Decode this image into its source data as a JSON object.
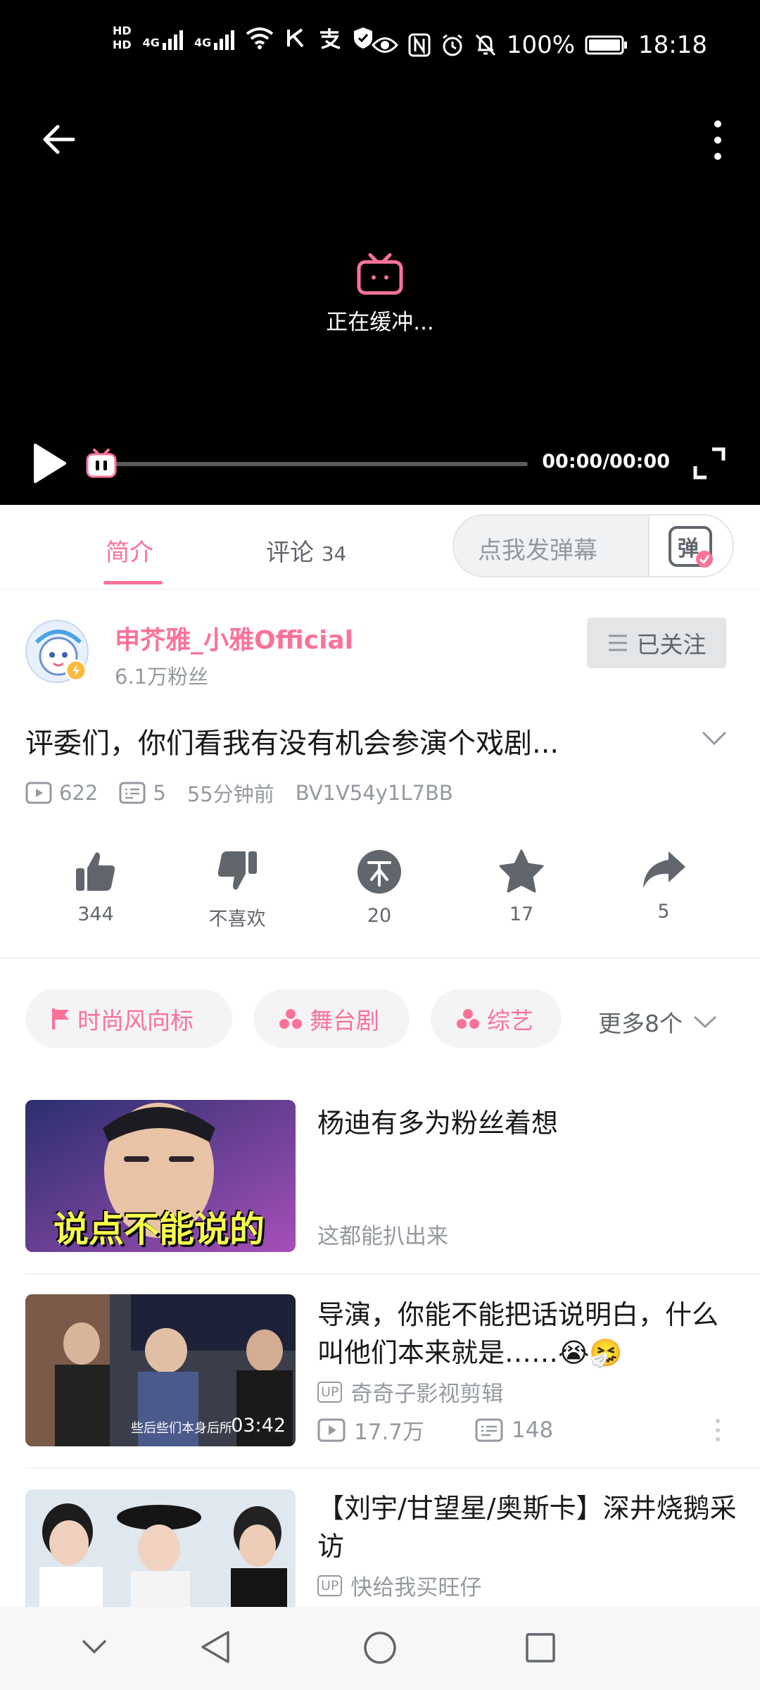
{
  "status_bar": {
    "hd1": "HD",
    "hd2": "HD",
    "net1": "4G",
    "net2": "4G",
    "battery": "100%",
    "time": "18:18"
  },
  "player": {
    "buffering_text": "正在缓冲...",
    "time_display": "00:00/00:00"
  },
  "tabs": {
    "intro_label": "简介",
    "comments_label": "评论",
    "comments_count": "34",
    "danmaku_placeholder": "点我发弹幕",
    "danmaku_button": "弹"
  },
  "up": {
    "name": "申芥雅_小雅Official",
    "fans": "6.1万粉丝",
    "follow_label": "已关注"
  },
  "video": {
    "title": "评委们，你们看我有没有机会参演个戏剧...",
    "views": "622",
    "danmaku_count": "5",
    "posted": "55分钟前",
    "bvid": "BV1V54y1L7BB"
  },
  "actions": {
    "like": "344",
    "dislike": "不喜欢",
    "coin": "20",
    "favorite": "17",
    "share": "5"
  },
  "tags": {
    "items": [
      "时尚风向标",
      "舞台剧",
      "综艺"
    ],
    "more": "更多8个"
  },
  "recommendations": [
    {
      "title": "杨迪有多为粉丝着想",
      "subtitle": "这都能扒出来",
      "thumb_caption": "说点不能说的"
    },
    {
      "title": "导演，你能不能把话说明白，什么叫他们本来就是……😭🤧",
      "up_badge": "UP",
      "author": "奇奇子影视剪辑",
      "views": "17.7万",
      "danmaku": "148",
      "duration": "03:42",
      "thumb_caption": "些后些们本身后所"
    },
    {
      "title": "【刘宇/甘望星/奥斯卡】深井烧鹅采访",
      "up_badge": "UP",
      "author": "快给我买旺仔"
    }
  ],
  "colors": {
    "accent": "#fb7299",
    "text": "#18191c",
    "muted": "#9499a0"
  }
}
